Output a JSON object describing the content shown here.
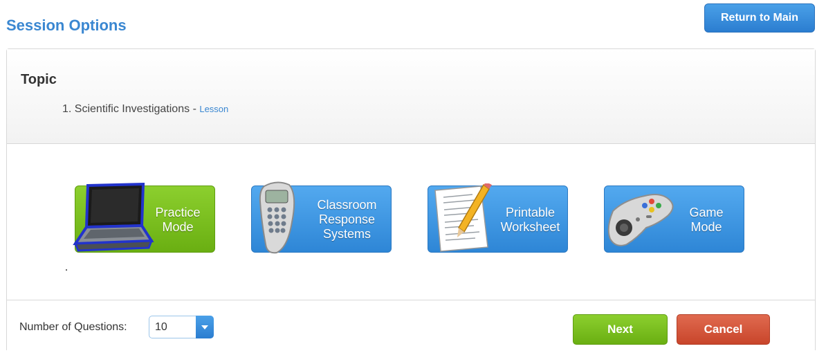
{
  "page": {
    "title": "Session Options",
    "return_label": "Return to Main"
  },
  "topic": {
    "heading": "Topic",
    "items": [
      {
        "number": "1.",
        "name": "Scientific Investigations",
        "separator": "-",
        "link": "Lesson"
      }
    ]
  },
  "modes": [
    {
      "label_lines": [
        "Practice",
        "Mode"
      ],
      "icon": "laptop-icon",
      "color": "#7cbf22",
      "selected": true
    },
    {
      "label_lines": [
        "Classroom",
        "Response",
        "Systems"
      ],
      "icon": "clicker-remote-icon",
      "color": "#3a92df",
      "selected": false
    },
    {
      "label_lines": [
        "Printable",
        "Worksheet"
      ],
      "icon": "worksheet-pencil-icon",
      "color": "#3a92df",
      "selected": false
    },
    {
      "label_lines": [
        "Game",
        "Mode"
      ],
      "icon": "gamepad-icon",
      "color": "#3a92df",
      "selected": false
    }
  ],
  "footer": {
    "questions_label": "Number of Questions:",
    "questions_value": "10",
    "next_label": "Next",
    "cancel_label": "Cancel"
  },
  "colors": {
    "accent_blue": "#3a87d1",
    "green": "#7cbf22",
    "red": "#d2553a"
  }
}
